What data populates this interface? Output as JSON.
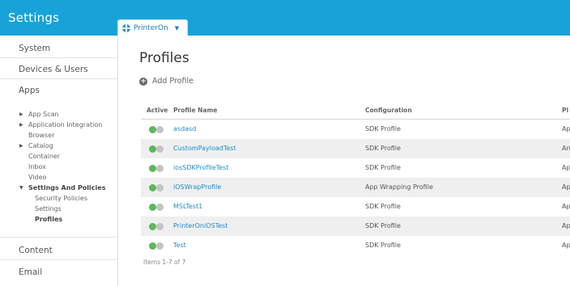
{
  "app": {
    "title": "Settings"
  },
  "org_selector": {
    "value": "PrinterOn"
  },
  "sidebar": {
    "sections": [
      "System",
      "Devices & Users",
      "Apps",
      "Content",
      "Email"
    ],
    "apps_tree": [
      {
        "label": "App Scan",
        "expandable": true
      },
      {
        "label": "Application Integration",
        "expandable": true
      },
      {
        "label": "Browser",
        "expandable": false
      },
      {
        "label": "Catalog",
        "expandable": true
      },
      {
        "label": "Container",
        "expandable": false
      },
      {
        "label": "Inbox",
        "expandable": false
      },
      {
        "label": "Video",
        "expandable": false
      },
      {
        "label": "Settings And Policies",
        "expanded": true
      },
      {
        "label": "Security Policies"
      },
      {
        "label": "Settings"
      },
      {
        "label": "Profiles",
        "selected": true
      }
    ]
  },
  "main": {
    "title": "Profiles",
    "add_label": "Add Profile",
    "columns": [
      "Active",
      "Profile Name",
      "Configuration",
      "Pl"
    ],
    "rows": [
      {
        "name": "asdasd",
        "configuration": "SDK Profile",
        "platform": "Ap"
      },
      {
        "name": "CustomPayloadTest",
        "configuration": "SDK Profile",
        "platform": "An"
      },
      {
        "name": "iosSDKProfileTest",
        "configuration": "SDK Profile",
        "platform": "Ap"
      },
      {
        "name": "iOSWrapProfile",
        "configuration": "App Wrapping Profile",
        "platform": "Ap"
      },
      {
        "name": "MSLTest1",
        "configuration": "SDK Profile",
        "platform": "Ap"
      },
      {
        "name": "PrinterOniOSTest",
        "configuration": "SDK Profile",
        "platform": "Ap"
      },
      {
        "name": "Test",
        "configuration": "SDK Profile",
        "platform": "Ap"
      }
    ],
    "footer": "Items 1-7 of 7"
  },
  "colors": {
    "accent": "#17a3d8",
    "link": "#1e8fc6",
    "active": "#5cb85c",
    "inactive": "#c4c4c4"
  }
}
